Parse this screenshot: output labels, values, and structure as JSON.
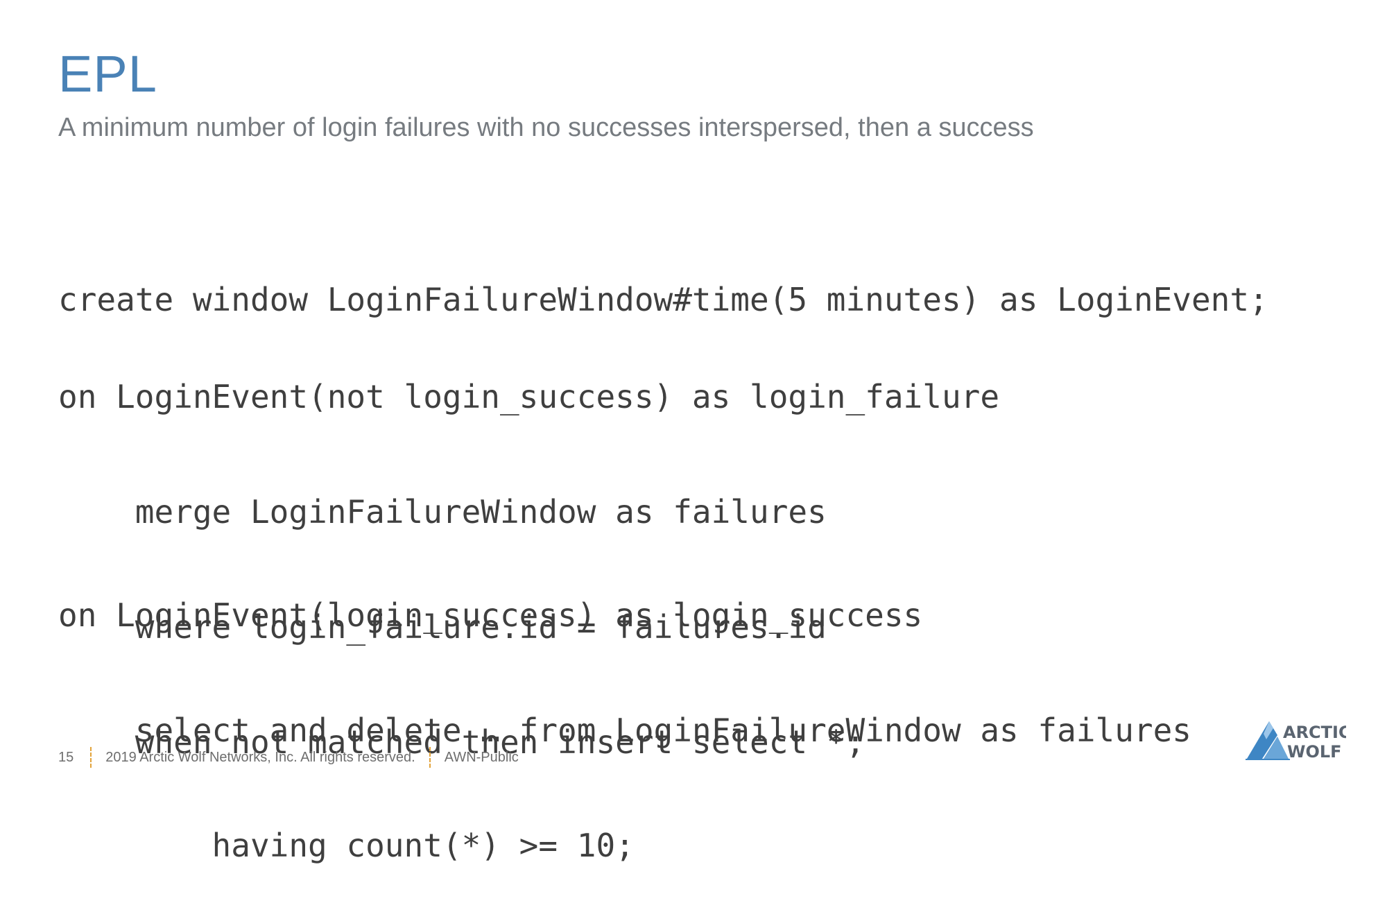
{
  "slide": {
    "title": "EPL",
    "subtitle": "A minimum number of login failures with no successes interspersed, then a success"
  },
  "code": {
    "block1": [
      "create window LoginFailureWindow#time(5 minutes) as LoginEvent;"
    ],
    "block2": [
      "on LoginEvent(not login_success) as login_failure",
      "    merge LoginFailureWindow as failures",
      "    where login_failure.id = failures.id",
      "    when not matched then insert select *;"
    ],
    "block3": [
      "on LoginEvent(login_success) as login_success",
      "    select and delete … from LoginFailureWindow as failures",
      "        having count(*) >= 10;"
    ]
  },
  "footer": {
    "page_number": "15",
    "copyright": "2019 Arctic Wolf Networks, Inc. All rights reserved.",
    "classification": "AWN-Public"
  },
  "logo": {
    "line1": "ARCTIC",
    "line2": "WOLF",
    "icon": "arctic-wolf-logo-icon"
  },
  "colors": {
    "title": "#4a82b6",
    "subtitle": "#767b80",
    "code": "#3f3f3f",
    "divider": "#e2a33a",
    "logo_blue": "#3e86c4",
    "logo_text": "#5a6470"
  }
}
